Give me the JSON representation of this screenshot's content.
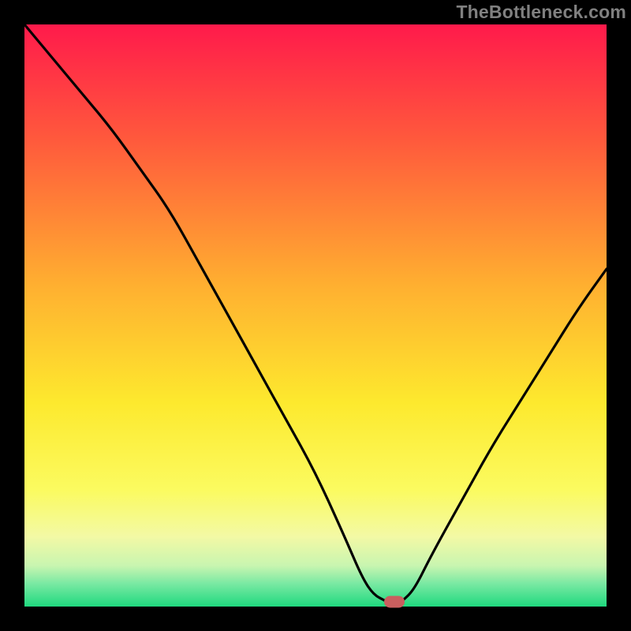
{
  "watermark": {
    "text": "TheBottleneck.com"
  },
  "marker": {
    "x_pct": 63.5,
    "y_pct": 99.2,
    "color": "#C95F5F"
  },
  "gradient": {
    "stops": [
      {
        "pct": 0,
        "color": "#FF1A4B"
      },
      {
        "pct": 20,
        "color": "#FF5A3C"
      },
      {
        "pct": 45,
        "color": "#FFB030"
      },
      {
        "pct": 65,
        "color": "#FDE92E"
      },
      {
        "pct": 80,
        "color": "#FBFB60"
      },
      {
        "pct": 88,
        "color": "#F3F9A5"
      },
      {
        "pct": 93,
        "color": "#C8F5B0"
      },
      {
        "pct": 96,
        "color": "#7BE9A3"
      },
      {
        "pct": 100,
        "color": "#1FD97F"
      }
    ]
  },
  "chart_data": {
    "type": "line",
    "title": "",
    "xlabel": "",
    "ylabel": "",
    "xlim": [
      0,
      100
    ],
    "ylim": [
      0,
      100
    ],
    "series": [
      {
        "name": "bottleneck-curve",
        "x": [
          0,
          5,
          10,
          15,
          20,
          25,
          30,
          35,
          40,
          45,
          50,
          55,
          58,
          60,
          62,
          63.5,
          65,
          67,
          70,
          75,
          80,
          85,
          90,
          95,
          100
        ],
        "y": [
          100,
          94,
          88,
          82,
          75,
          68,
          59,
          50,
          41,
          32,
          23,
          12,
          5,
          2,
          1,
          0,
          1,
          3,
          9,
          18,
          27,
          35,
          43,
          51,
          58
        ]
      }
    ],
    "annotations": [
      {
        "type": "marker",
        "x": 63.5,
        "y": 0,
        "label": "optimal-point"
      }
    ],
    "background": "vertical-gradient red→yellow→green (green at bottom)"
  }
}
